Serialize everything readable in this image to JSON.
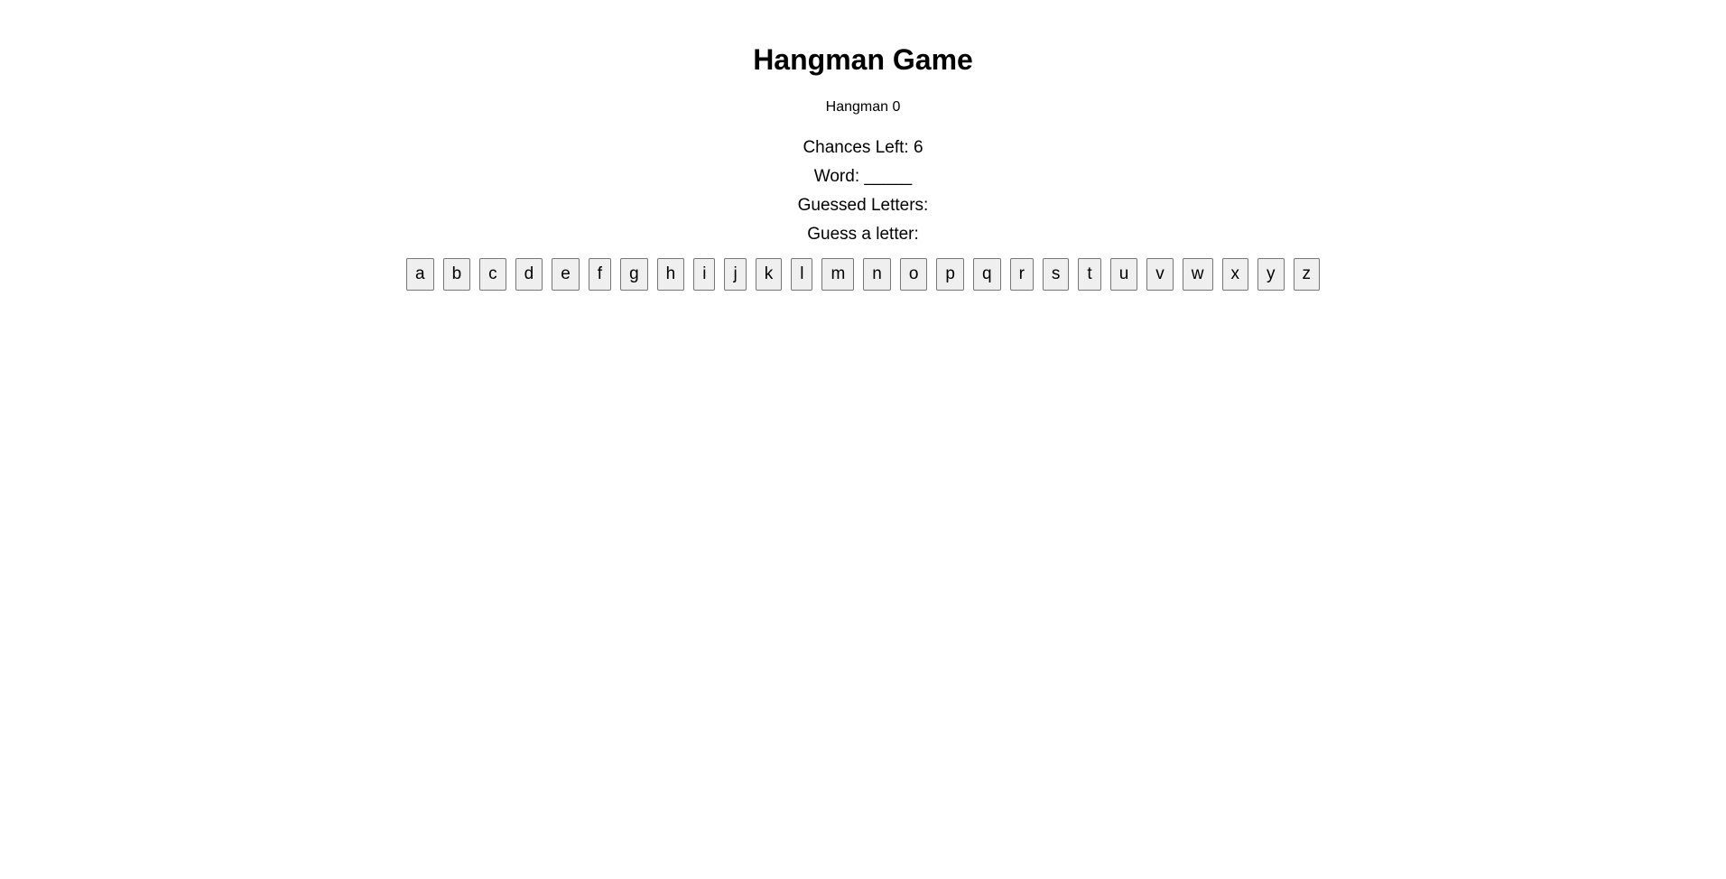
{
  "title": "Hangman Game",
  "image": {
    "alt_text": "Hangman 0"
  },
  "status": {
    "chances_label": "Chances Left:",
    "chances_value": "6",
    "word_label": "Word:",
    "word_value": "_____",
    "guessed_label": "Guessed Letters:",
    "guessed_value": "",
    "prompt": "Guess a letter:"
  },
  "letters": [
    "a",
    "b",
    "c",
    "d",
    "e",
    "f",
    "g",
    "h",
    "i",
    "j",
    "k",
    "l",
    "m",
    "n",
    "o",
    "p",
    "q",
    "r",
    "s",
    "t",
    "u",
    "v",
    "w",
    "x",
    "y",
    "z"
  ]
}
